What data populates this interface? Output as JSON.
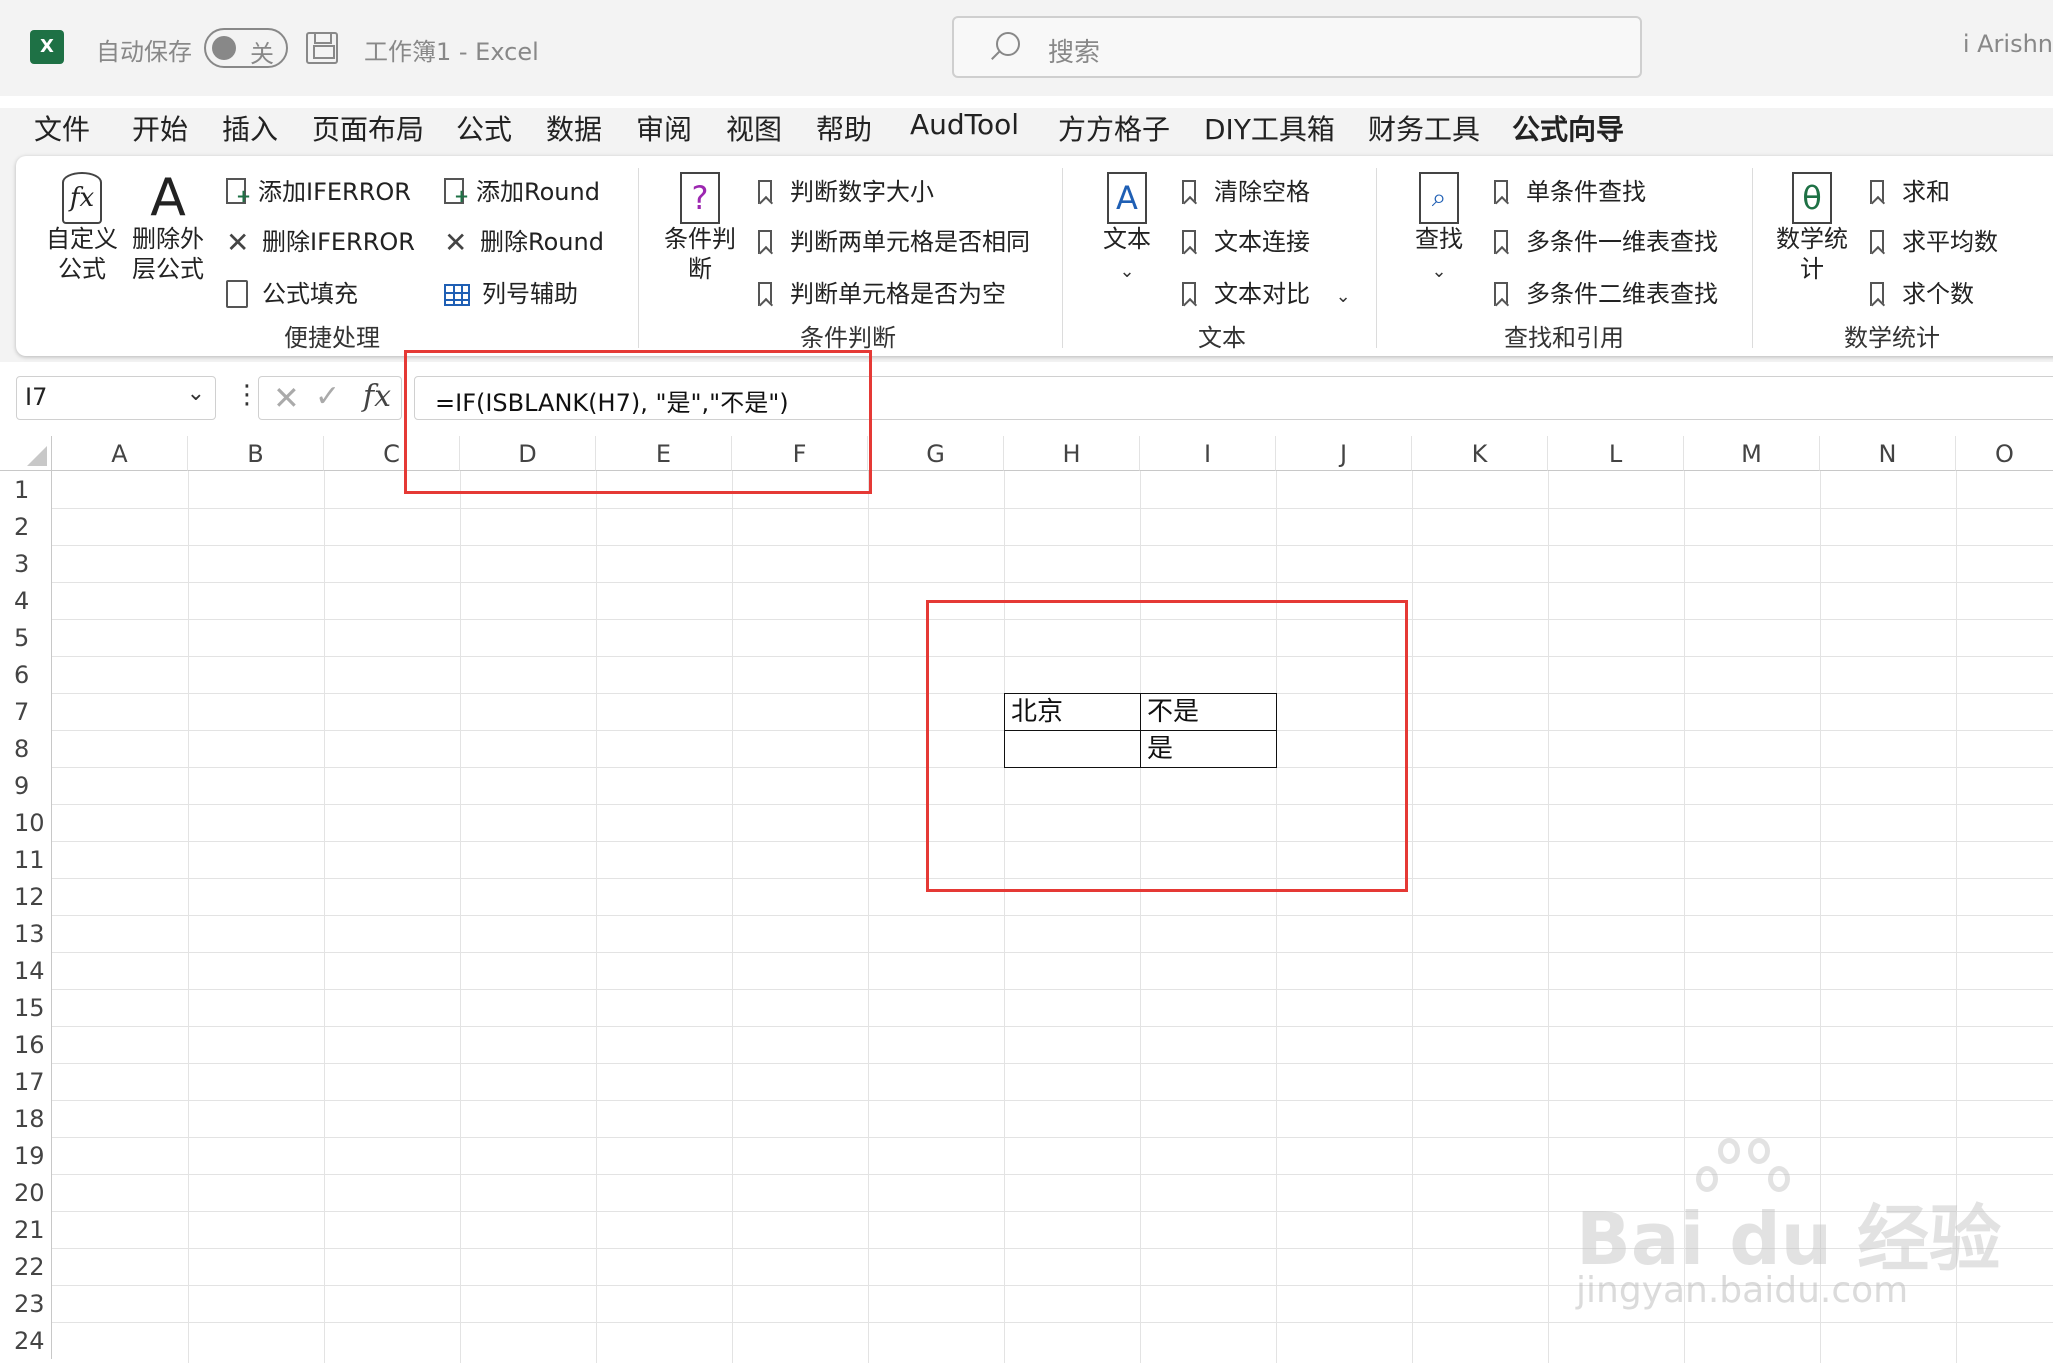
{
  "titlebar": {
    "app_icon": "excel-logo",
    "autosave_label": "自动保存",
    "autosave_state": "关",
    "doc_title": "工作簿1  -  Excel",
    "search_placeholder": "搜索",
    "user_name": "i Arishn"
  },
  "tabs": [
    "文件",
    "开始",
    "插入",
    "页面布局",
    "公式",
    "数据",
    "审阅",
    "视图",
    "帮助",
    "AudTool",
    "方方格子",
    "DIY工具箱",
    "财务工具",
    "公式向导"
  ],
  "active_tab": "公式向导",
  "ribbon": {
    "convenient": {
      "big1": "自定义\n公式",
      "big2": "删除外\n层公式",
      "items": [
        "添加IFERROR",
        "删除IFERROR",
        "公式填充",
        "添加Round",
        "删除Round",
        "列号辅助"
      ],
      "label": "便捷处理"
    },
    "condition": {
      "big": "条件判\n断",
      "items": [
        "判断数字大小",
        "判断两单元格是否相同",
        "判断单元格是否为空"
      ],
      "label": "条件判断"
    },
    "text": {
      "big": "文本",
      "items": [
        "清除空格",
        "文本连接",
        "文本对比"
      ],
      "label": "文本"
    },
    "lookup": {
      "big": "查找",
      "items": [
        "单条件查找",
        "多条件一维表查找",
        "多条件二维表查找"
      ],
      "label": "查找和引用"
    },
    "math": {
      "big": "数学统\n计",
      "items": [
        "求和",
        "求平均数",
        "求个数"
      ],
      "label": "数学统计"
    }
  },
  "namebox": "I7",
  "formula": "=IF(ISBLANK(H7), \"是\",\"不是\")",
  "columns": [
    "A",
    "B",
    "C",
    "D",
    "E",
    "F",
    "G",
    "H",
    "I",
    "J",
    "K",
    "L",
    "M",
    "N",
    "O"
  ],
  "rows": [
    "1",
    "2",
    "3",
    "4",
    "5",
    "6",
    "7",
    "8",
    "9",
    "10",
    "11",
    "12",
    "13",
    "14",
    "15",
    "16",
    "17",
    "18",
    "19",
    "20",
    "21",
    "22",
    "23",
    "24"
  ],
  "cells": {
    "H7": "北京",
    "I7": "不是",
    "H8": "",
    "I8": "是"
  },
  "watermark": {
    "brand": "Bai du 经验",
    "url": "jingyan.baidu.com"
  },
  "colors": {
    "excel_green": "#1e7145",
    "highlight_red": "#e53935"
  }
}
